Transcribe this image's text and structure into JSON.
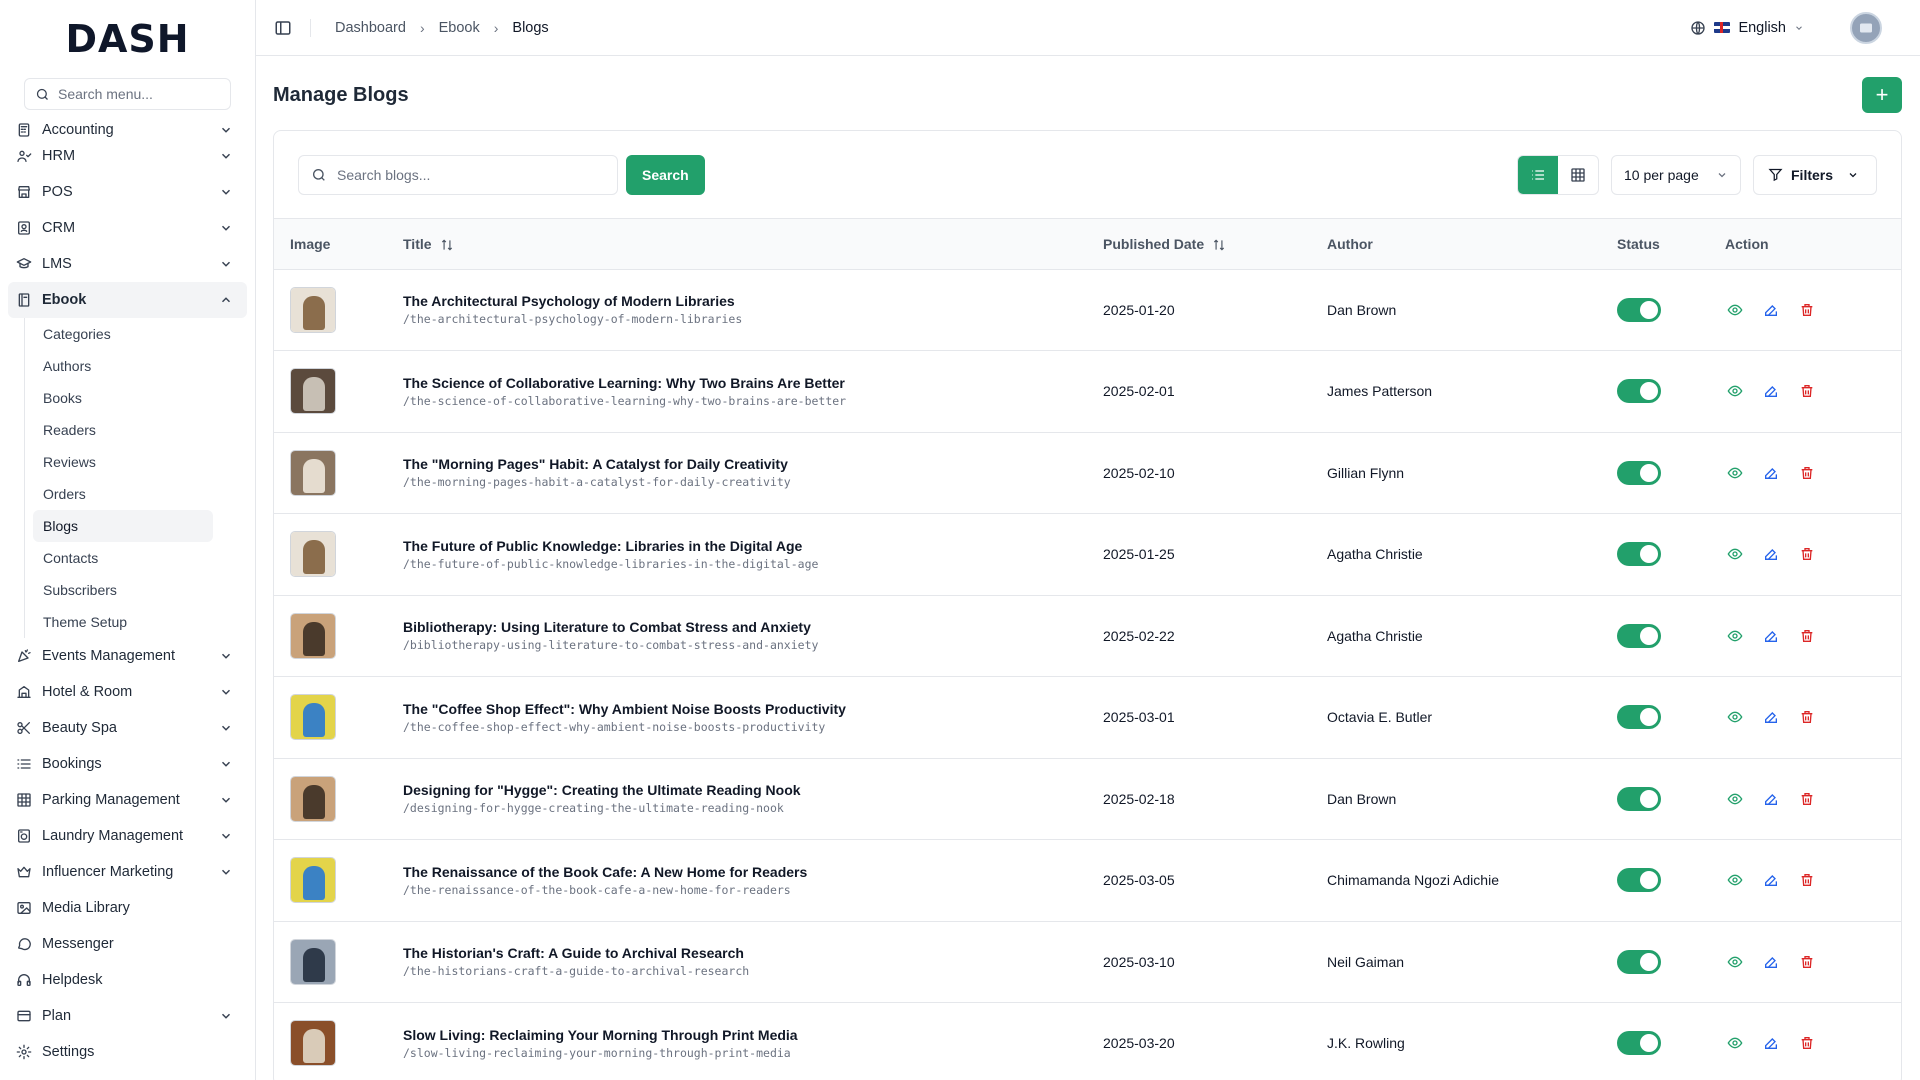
{
  "brand": {
    "logo": "DASH"
  },
  "sidebar": {
    "search_placeholder": "Search menu...",
    "items": [
      {
        "label": "Accounting",
        "icon": "calculator-icon",
        "chevron": true
      },
      {
        "label": "HRM",
        "icon": "users-icon",
        "chevron": true
      },
      {
        "label": "POS",
        "icon": "store-icon",
        "chevron": true
      },
      {
        "label": "CRM",
        "icon": "contact-icon",
        "chevron": true
      },
      {
        "label": "LMS",
        "icon": "graduation-cap-icon",
        "chevron": true
      },
      {
        "label": "Ebook",
        "icon": "book-icon",
        "chevron": true,
        "expanded": true
      }
    ],
    "ebook_children": [
      "Categories",
      "Authors",
      "Books",
      "Readers",
      "Reviews",
      "Orders",
      "Blogs",
      "Contacts",
      "Subscribers",
      "Theme Setup"
    ],
    "ebook_active_child": "Blogs",
    "items_after": [
      {
        "label": "Events Management",
        "icon": "party-icon",
        "chevron": true
      },
      {
        "label": "Hotel & Room",
        "icon": "hotel-icon",
        "chevron": true
      },
      {
        "label": "Beauty Spa",
        "icon": "scissors-icon",
        "chevron": true
      },
      {
        "label": "Bookings",
        "icon": "list-icon",
        "chevron": true
      },
      {
        "label": "Parking Management",
        "icon": "grid-icon",
        "chevron": true
      },
      {
        "label": "Laundry Management",
        "icon": "washing-machine-icon",
        "chevron": true
      },
      {
        "label": "Influencer Marketing",
        "icon": "crown-icon",
        "chevron": true
      },
      {
        "label": "Media Library",
        "icon": "image-icon",
        "chevron": false
      },
      {
        "label": "Messenger",
        "icon": "message-icon",
        "chevron": false
      },
      {
        "label": "Helpdesk",
        "icon": "headphones-icon",
        "chevron": false
      },
      {
        "label": "Plan",
        "icon": "card-icon",
        "chevron": true
      },
      {
        "label": "Settings",
        "icon": "gear-icon",
        "chevron": false
      }
    ]
  },
  "topbar": {
    "breadcrumb": [
      "Dashboard",
      "Ebook",
      "Blogs"
    ],
    "language": "English"
  },
  "page": {
    "title": "Manage Blogs",
    "add_label": "+"
  },
  "toolbar": {
    "search_placeholder": "Search blogs...",
    "search_button": "Search",
    "per_page": "10 per page",
    "filters": "Filters"
  },
  "table": {
    "columns": [
      "Image",
      "Title",
      "Published Date",
      "Author",
      "Status",
      "Action"
    ],
    "rows": [
      {
        "title": "The Architectural Psychology of Modern Libraries",
        "slug": "/the-architectural-psychology-of-modern-libraries",
        "date": "2025-01-20",
        "author": "Dan Brown",
        "status": true,
        "thumb": [
          "#8b6d4c",
          "#e8e1d6"
        ]
      },
      {
        "title": "The Science of Collaborative Learning: Why Two Brains Are Better",
        "slug": "/the-science-of-collaborative-learning-why-two-brains-are-better",
        "date": "2025-02-01",
        "author": "James Patterson",
        "status": true,
        "thumb": [
          "#c7bfb4",
          "#5b4a3d"
        ]
      },
      {
        "title": "The \"Morning Pages\" Habit: A Catalyst for Daily Creativity",
        "slug": "/the-morning-pages-habit-a-catalyst-for-daily-creativity",
        "date": "2025-02-10",
        "author": "Gillian Flynn",
        "status": true,
        "thumb": [
          "#e5dccf",
          "#8a7560"
        ]
      },
      {
        "title": "The Future of Public Knowledge: Libraries in the Digital Age",
        "slug": "/the-future-of-public-knowledge-libraries-in-the-digital-age",
        "date": "2025-01-25",
        "author": "Agatha Christie",
        "status": true,
        "thumb": [
          "#8b6d4c",
          "#e8e1d6"
        ]
      },
      {
        "title": "Bibliotherapy: Using Literature to Combat Stress and Anxiety",
        "slug": "/bibliotherapy-using-literature-to-combat-stress-and-anxiety",
        "date": "2025-02-22",
        "author": "Agatha Christie",
        "status": true,
        "thumb": [
          "#4a3a2c",
          "#c9a27a"
        ]
      },
      {
        "title": "The \"Coffee Shop Effect\": Why Ambient Noise Boosts Productivity",
        "slug": "/the-coffee-shop-effect-why-ambient-noise-boosts-productivity",
        "date": "2025-03-01",
        "author": "Octavia E. Butler",
        "status": true,
        "thumb": [
          "#3b82c4",
          "#e3d44a"
        ]
      },
      {
        "title": "Designing for \"Hygge\": Creating the Ultimate Reading Nook",
        "slug": "/designing-for-hygge-creating-the-ultimate-reading-nook",
        "date": "2025-02-18",
        "author": "Dan Brown",
        "status": true,
        "thumb": [
          "#4a3a2c",
          "#c9a27a"
        ]
      },
      {
        "title": "The Renaissance of the Book Cafe: A New Home for Readers",
        "slug": "/the-renaissance-of-the-book-cafe-a-new-home-for-readers",
        "date": "2025-03-05",
        "author": "Chimamanda Ngozi Adichie",
        "status": true,
        "thumb": [
          "#3b82c4",
          "#e3d44a"
        ]
      },
      {
        "title": "The Historian's Craft: A Guide to Archival Research",
        "slug": "/the-historians-craft-a-guide-to-archival-research",
        "date": "2025-03-10",
        "author": "Neil Gaiman",
        "status": true,
        "thumb": [
          "#2f3a4a",
          "#9aa6b5"
        ]
      },
      {
        "title": "Slow Living: Reclaiming Your Morning Through Print Media",
        "slug": "/slow-living-reclaiming-your-morning-through-print-media",
        "date": "2025-03-20",
        "author": "J.K. Rowling",
        "status": true,
        "thumb": [
          "#d9cbb8",
          "#8a4f2a"
        ]
      }
    ]
  },
  "colors": {
    "accent": "#22a06b",
    "view_icon": "#22a06b",
    "edit_icon": "#2563eb",
    "delete_icon": "#dc2626"
  }
}
